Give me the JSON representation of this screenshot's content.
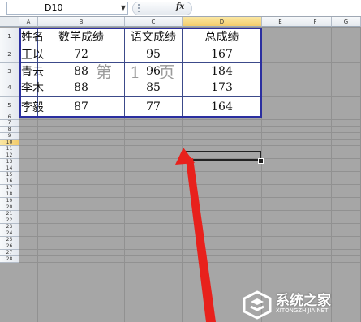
{
  "formula_bar": {
    "name_box": "D10",
    "fx_label": "fx",
    "formula": ""
  },
  "columns": [
    "A",
    "B",
    "C",
    "D",
    "E",
    "F",
    "G"
  ],
  "rows": [
    "1",
    "2",
    "3",
    "4",
    "5",
    "6",
    "7",
    "8",
    "9",
    "10",
    "11",
    "12",
    "13",
    "14",
    "15",
    "16",
    "17",
    "18",
    "19",
    "20",
    "21",
    "22",
    "23",
    "24",
    "25",
    "26",
    "27",
    "28"
  ],
  "selected": {
    "column": "D",
    "row": "10"
  },
  "table": {
    "header": [
      "姓名",
      "数学成绩",
      "语文成绩",
      "总成绩"
    ],
    "rows": [
      [
        "王以",
        "72",
        "95",
        "167"
      ],
      [
        "青云",
        "88",
        "96",
        "184"
      ],
      [
        "李木",
        "88",
        "85",
        "173"
      ],
      [
        "李毅",
        "87",
        "77",
        "164"
      ]
    ]
  },
  "page_watermark": "第 1 页",
  "site_logo": {
    "name": "系统之家",
    "url": "XITONGZHIJIA.NET"
  },
  "colors": {
    "table_border": "#2b2fa0",
    "arrow": "#e8211c",
    "selected_header": "#f3cc6c",
    "background": "#a6a6a6"
  }
}
